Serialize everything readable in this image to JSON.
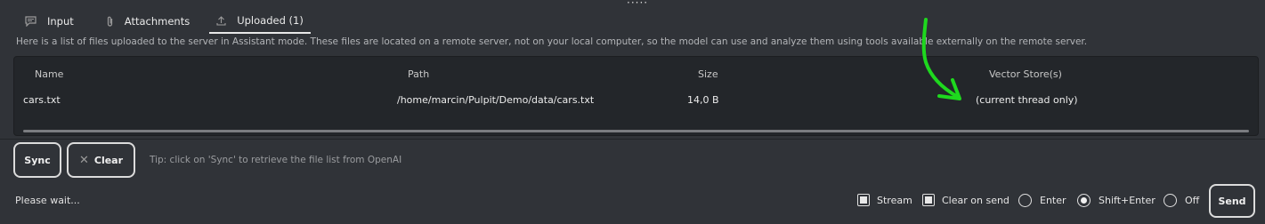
{
  "drag_handle": "·····",
  "tabs": [
    {
      "label": "Input",
      "icon": "chat-bubble-icon"
    },
    {
      "label": "Attachments",
      "icon": "paperclip-icon"
    },
    {
      "label": "Uploaded (1)",
      "icon": "upload-icon",
      "active": true
    }
  ],
  "description": "Here is a list of files uploaded to the server in Assistant mode. These files are located on a remote server, not on your local computer, so the model can use and analyze them using tools available externally on the remote server.",
  "table": {
    "headers": {
      "name": "Name",
      "path": "Path",
      "size": "Size",
      "vector_store": "Vector Store(s)"
    },
    "rows": [
      {
        "name": "cars.txt",
        "path": "/home/marcin/Pulpit/Demo/data/cars.txt",
        "size": "14,0 B",
        "vector_store": "(current thread only)"
      }
    ]
  },
  "actions": {
    "sync_label": "Sync",
    "clear_label": "Clear",
    "tip": "Tip: click on 'Sync' to retrieve the file list from OpenAI"
  },
  "status": "Please wait...",
  "options": {
    "stream": {
      "label": "Stream",
      "checked": true
    },
    "clear_on_send": {
      "label": "Clear on send",
      "checked": true
    },
    "enter": {
      "label": "Enter",
      "selected": false
    },
    "shift_enter": {
      "label": "Shift+Enter",
      "selected": true
    },
    "off": {
      "label": "Off",
      "selected": false
    }
  },
  "send_label": "Send",
  "colors": {
    "background": "#303338",
    "table_bg": "#23262a",
    "annotation_arrow": "#1ed81e"
  }
}
